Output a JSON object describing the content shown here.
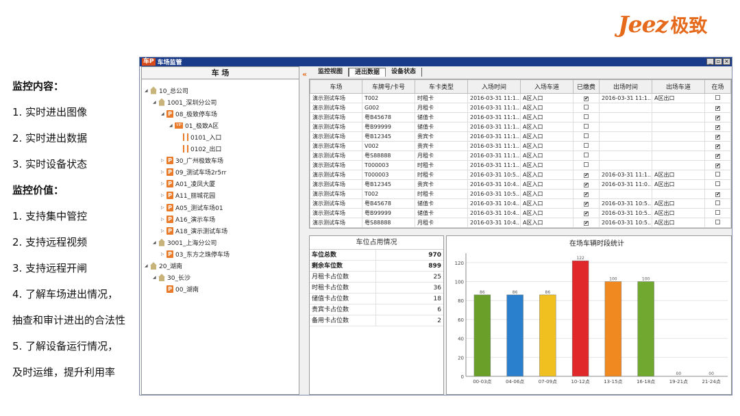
{
  "logo": {
    "en": "Jeez",
    "cn": "极致"
  },
  "bullets": [
    {
      "text": "监控内容：",
      "bold": true
    },
    {
      "text": "1. 实时进出图像"
    },
    {
      "text": "2. 实时进出数据"
    },
    {
      "text": "3. 实时设备状态"
    },
    {
      "text": "监控价值：",
      "bold": true
    },
    {
      "text": "1. 支持集中管控"
    },
    {
      "text": "2. 支持远程视频"
    },
    {
      "text": "3. 支持远程开闸"
    },
    {
      "text": "4. 了解车场进出情况，"
    },
    {
      "text": "抽查和审计进出的合法性"
    },
    {
      "text": "5. 了解设备运行情况，"
    },
    {
      "text": "及时运维，提升利用率"
    }
  ],
  "window": {
    "logo": "车P",
    "title": "车场监管",
    "buttons": [
      "_",
      "▫",
      "×"
    ]
  },
  "tree": {
    "header": "车 场",
    "collapse": "«",
    "nodes": [
      {
        "label": "10_总公司",
        "icon": "house",
        "level": 0,
        "exp": "◢"
      },
      {
        "label": "1001_深圳分公司",
        "icon": "house",
        "level": 1,
        "exp": "◢"
      },
      {
        "label": "08_极致停车场",
        "icon": "park",
        "level": 2,
        "exp": "◢"
      },
      {
        "label": "01_极致A区",
        "icon": "zone",
        "level": 3,
        "exp": "◢"
      },
      {
        "label": "0101_入口",
        "icon": "gate",
        "level": 4,
        "exp": ""
      },
      {
        "label": "0102_出口",
        "icon": "gate",
        "level": 4,
        "exp": ""
      },
      {
        "label": "30_广州极致车场",
        "icon": "park",
        "level": 2,
        "exp": "▷"
      },
      {
        "label": "09_测试车场2r5rr",
        "icon": "park",
        "level": 2,
        "exp": "▷"
      },
      {
        "label": "A01_凌凤大厦",
        "icon": "park",
        "level": 2,
        "exp": "▷"
      },
      {
        "label": "A11_丽城花园",
        "icon": "park",
        "level": 2,
        "exp": "▷"
      },
      {
        "label": "A05_测试车场01",
        "icon": "park",
        "level": 2,
        "exp": "▷"
      },
      {
        "label": "A16_演示车场",
        "icon": "park",
        "level": 2,
        "exp": "▷"
      },
      {
        "label": "A18_演示测试车场",
        "icon": "park",
        "level": 2,
        "exp": "▷"
      },
      {
        "label": "3001_上海分公司",
        "icon": "house",
        "level": 1,
        "exp": "◢"
      },
      {
        "label": "03_东方之珠停车场",
        "icon": "park",
        "level": 2,
        "exp": "▷"
      },
      {
        "label": "20_湖南",
        "icon": "house",
        "level": 0,
        "exp": "◢"
      },
      {
        "label": "30_长沙",
        "icon": "house",
        "level": 1,
        "exp": "◢"
      },
      {
        "label": "00_湖南",
        "icon": "park",
        "level": 2,
        "exp": ""
      }
    ]
  },
  "tabs": [
    "监控视图",
    "进出数据",
    "设备状态"
  ],
  "active_tab": 1,
  "grid": {
    "columns": [
      "车场",
      "车牌号/卡号",
      "车卡类型",
      "入场时间",
      "入场车道",
      "已缴费",
      "出场时间",
      "出场车道",
      "在场"
    ],
    "rows": [
      [
        "演示测试车场",
        "T002",
        "时租卡",
        "2016-03-31  11:1...",
        "A区入口",
        "✔",
        "2016-03-31  11:1...",
        "A区出口",
        ""
      ],
      [
        "演示测试车场",
        "G002",
        "月租卡",
        "2016-03-31  11:1...",
        "A区入口",
        "",
        "",
        "",
        "✔"
      ],
      [
        "演示测试车场",
        "粤B45678",
        "储值卡",
        "2016-03-31  11:1...",
        "A区入口",
        "",
        "",
        "",
        "✔"
      ],
      [
        "演示测试车场",
        "粤B99999",
        "储值卡",
        "2016-03-31  11:1...",
        "A区入口",
        "",
        "",
        "",
        "✔"
      ],
      [
        "演示测试车场",
        "粤B12345",
        "贵宾卡",
        "2016-03-31  11:1...",
        "A区入口",
        "",
        "",
        "",
        "✔"
      ],
      [
        "演示测试车场",
        "V002",
        "贵宾卡",
        "2016-03-31  11:1...",
        "A区入口",
        "",
        "",
        "",
        "✔"
      ],
      [
        "演示测试车场",
        "粤S88888",
        "月租卡",
        "2016-03-31  11:1...",
        "A区入口",
        "",
        "",
        "",
        "✔"
      ],
      [
        "演示测试车场",
        "T000003",
        "时租卡",
        "2016-03-31  11:1...",
        "A区入口",
        "",
        "",
        "",
        "✔"
      ],
      [
        "演示测试车场",
        "T000003",
        "时租卡",
        "2016-03-31  10:5...",
        "A区入口",
        "✔",
        "2016-03-31  11:1...",
        "A区出口",
        ""
      ],
      [
        "演示测试车场",
        "粤B12345",
        "贵宾卡",
        "2016-03-31  10:4...",
        "A区入口",
        "✔",
        "2016-03-31  11:0...",
        "A区出口",
        ""
      ],
      [
        "演示测试车场",
        "T002",
        "时租卡",
        "2016-03-31  10:5...",
        "A区入口",
        "✔",
        "",
        "",
        "✔"
      ],
      [
        "演示测试车场",
        "粤B45678",
        "储值卡",
        "2016-03-31  10:4...",
        "A区入口",
        "✔",
        "2016-03-31  10:5...",
        "A区出口",
        ""
      ],
      [
        "演示测试车场",
        "粤B99999",
        "储值卡",
        "2016-03-31  10:4...",
        "A区入口",
        "✔",
        "2016-03-31  10:5...",
        "A区出口",
        ""
      ],
      [
        "演示测试车场",
        "粤S88888",
        "月租卡",
        "2016-03-31  10:4...",
        "A区入口",
        "✔",
        "2016-03-31  10:5...",
        "A区出口",
        ""
      ]
    ]
  },
  "occupancy": {
    "title": "车位占用情况",
    "rows": [
      {
        "label": "车位总数",
        "value": "970",
        "bold": true
      },
      {
        "label": "剩余车位数",
        "value": "899",
        "bold": true
      },
      {
        "label": "月租卡占位数",
        "value": "25"
      },
      {
        "label": "时租卡占位数",
        "value": "36"
      },
      {
        "label": "储值卡占位数",
        "value": "18"
      },
      {
        "label": "贵宾卡占位数",
        "value": "6"
      },
      {
        "label": "备用卡占位数",
        "value": "2"
      }
    ]
  },
  "chart_data": {
    "type": "bar",
    "title": "在场车辆时段统计",
    "categories": [
      "00-03点",
      "04-06点",
      "07-09点",
      "10-12点",
      "13-15点",
      "16-18点",
      "19-21点",
      "21-24点"
    ],
    "values": [
      86,
      86,
      86,
      122,
      100,
      100,
      0,
      0
    ],
    "value_labels": [
      "86",
      "86",
      "86",
      "122",
      "100",
      "100",
      "00",
      "00"
    ],
    "colors": [
      "#6aa02a",
      "#2a80cc",
      "#f0c020",
      "#e0282a",
      "#f08a20",
      "#70a830",
      "#888888",
      "#888888"
    ],
    "ylim": [
      0,
      130
    ],
    "yticks": [
      0,
      20,
      40,
      60,
      80,
      100,
      120
    ],
    "grid": true
  }
}
